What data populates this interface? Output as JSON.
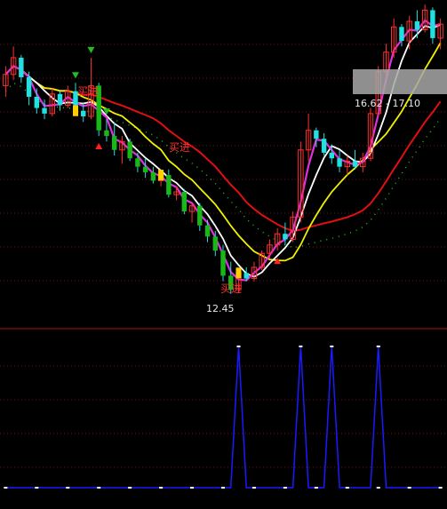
{
  "chart_data": [
    {
      "type": "candlestick",
      "panel": "main",
      "annotations": {
        "buy_labels": [
          "买进",
          "买进",
          "买进"
        ],
        "low_marker": "12.45",
        "price_range_readout": "16.62 - 17.10"
      },
      "candles": [
        {
          "o": 19.9,
          "h": 20.6,
          "l": 19.5,
          "c": 20.3,
          "up": true
        },
        {
          "o": 20.3,
          "h": 21.3,
          "l": 20.1,
          "c": 20.9,
          "up": true
        },
        {
          "o": 20.9,
          "h": 21.0,
          "l": 20.0,
          "c": 20.2,
          "up": false
        },
        {
          "o": 20.2,
          "h": 20.4,
          "l": 19.2,
          "c": 19.5,
          "up": false
        },
        {
          "o": 19.5,
          "h": 19.8,
          "l": 18.9,
          "c": 19.1,
          "up": false
        },
        {
          "o": 19.1,
          "h": 19.4,
          "l": 18.7,
          "c": 18.9,
          "up": false
        },
        {
          "o": 18.9,
          "h": 19.8,
          "l": 18.8,
          "c": 19.6,
          "up": true
        },
        {
          "o": 19.6,
          "h": 19.7,
          "l": 19.0,
          "c": 19.2,
          "up": false
        },
        {
          "o": 19.2,
          "h": 19.9,
          "l": 19.1,
          "c": 19.7,
          "up": true
        },
        {
          "o": 19.7,
          "h": 20.0,
          "l": 18.9,
          "c": 19.0,
          "up": false
        },
        {
          "o": 19.0,
          "h": 19.3,
          "l": 18.6,
          "c": 18.8,
          "up": false
        },
        {
          "o": 18.8,
          "h": 20.9,
          "l": 18.7,
          "c": 19.9,
          "up": true
        },
        {
          "o": 19.9,
          "h": 20.0,
          "l": 18.1,
          "c": 18.3,
          "up": false
        },
        {
          "o": 18.3,
          "h": 18.7,
          "l": 17.9,
          "c": 18.1,
          "up": false
        },
        {
          "o": 18.1,
          "h": 18.6,
          "l": 17.4,
          "c": 17.6,
          "up": false
        },
        {
          "o": 17.6,
          "h": 18.1,
          "l": 17.1,
          "c": 17.9,
          "up": true
        },
        {
          "o": 17.9,
          "h": 18.0,
          "l": 17.2,
          "c": 17.3,
          "up": false
        },
        {
          "o": 17.3,
          "h": 17.5,
          "l": 16.8,
          "c": 17.0,
          "up": false
        },
        {
          "o": 17.0,
          "h": 17.3,
          "l": 16.6,
          "c": 16.8,
          "up": false
        },
        {
          "o": 16.8,
          "h": 17.0,
          "l": 16.4,
          "c": 16.5,
          "up": false
        },
        {
          "o": 16.5,
          "h": 16.8,
          "l": 16.3,
          "c": 16.7,
          "up": true
        },
        {
          "o": 16.7,
          "h": 16.9,
          "l": 15.9,
          "c": 16.0,
          "up": false
        },
        {
          "o": 16.0,
          "h": 16.3,
          "l": 15.8,
          "c": 16.1,
          "up": true
        },
        {
          "o": 16.1,
          "h": 16.2,
          "l": 15.3,
          "c": 15.4,
          "up": false
        },
        {
          "o": 15.4,
          "h": 15.7,
          "l": 15.0,
          "c": 15.6,
          "up": true
        },
        {
          "o": 15.6,
          "h": 15.7,
          "l": 14.7,
          "c": 14.9,
          "up": false
        },
        {
          "o": 14.9,
          "h": 15.1,
          "l": 14.3,
          "c": 14.5,
          "up": false
        },
        {
          "o": 14.5,
          "h": 14.7,
          "l": 13.8,
          "c": 14.0,
          "up": false
        },
        {
          "o": 14.0,
          "h": 14.2,
          "l": 12.9,
          "c": 13.1,
          "up": false
        },
        {
          "o": 13.1,
          "h": 13.6,
          "l": 12.45,
          "c": 12.6,
          "up": false
        },
        {
          "o": 12.6,
          "h": 13.3,
          "l": 12.5,
          "c": 13.2,
          "up": true
        },
        {
          "o": 13.2,
          "h": 13.4,
          "l": 12.9,
          "c": 13.0,
          "up": false
        },
        {
          "o": 13.0,
          "h": 13.6,
          "l": 12.9,
          "c": 13.4,
          "up": true
        },
        {
          "o": 13.4,
          "h": 14.0,
          "l": 13.3,
          "c": 13.9,
          "up": true
        },
        {
          "o": 13.9,
          "h": 14.4,
          "l": 13.7,
          "c": 14.2,
          "up": true
        },
        {
          "o": 14.2,
          "h": 14.8,
          "l": 14.0,
          "c": 14.6,
          "up": true
        },
        {
          "o": 14.6,
          "h": 15.0,
          "l": 14.2,
          "c": 14.4,
          "up": false
        },
        {
          "o": 14.4,
          "h": 15.4,
          "l": 14.3,
          "c": 15.2,
          "up": true
        },
        {
          "o": 15.2,
          "h": 17.9,
          "l": 15.0,
          "c": 17.6,
          "up": true
        },
        {
          "o": 17.6,
          "h": 18.9,
          "l": 17.2,
          "c": 18.3,
          "up": true
        },
        {
          "o": 18.3,
          "h": 18.4,
          "l": 17.7,
          "c": 18.0,
          "up": false
        },
        {
          "o": 18.0,
          "h": 18.2,
          "l": 17.4,
          "c": 17.5,
          "up": false
        },
        {
          "o": 17.5,
          "h": 17.8,
          "l": 17.1,
          "c": 17.3,
          "up": false
        },
        {
          "o": 17.3,
          "h": 17.6,
          "l": 16.8,
          "c": 17.0,
          "up": false
        },
        {
          "o": 17.0,
          "h": 17.4,
          "l": 16.7,
          "c": 17.2,
          "up": true
        },
        {
          "o": 17.2,
          "h": 17.6,
          "l": 16.9,
          "c": 17.0,
          "up": false
        },
        {
          "o": 17.0,
          "h": 17.5,
          "l": 16.8,
          "c": 17.3,
          "up": true
        },
        {
          "o": 17.3,
          "h": 19.1,
          "l": 17.2,
          "c": 18.9,
          "up": true
        },
        {
          "o": 18.9,
          "h": 20.6,
          "l": 18.8,
          "c": 20.4,
          "up": true
        },
        {
          "o": 20.4,
          "h": 21.4,
          "l": 20.1,
          "c": 21.1,
          "up": true
        },
        {
          "o": 21.1,
          "h": 22.3,
          "l": 20.9,
          "c": 22.0,
          "up": true
        },
        {
          "o": 22.0,
          "h": 22.1,
          "l": 21.3,
          "c": 21.5,
          "up": false
        },
        {
          "o": 21.5,
          "h": 22.4,
          "l": 21.2,
          "c": 22.2,
          "up": true
        },
        {
          "o": 22.2,
          "h": 22.6,
          "l": 21.6,
          "c": 21.9,
          "up": false
        },
        {
          "o": 21.9,
          "h": 22.8,
          "l": 21.8,
          "c": 22.6,
          "up": true
        },
        {
          "o": 22.6,
          "h": 22.7,
          "l": 21.4,
          "c": 21.6,
          "up": false
        },
        {
          "o": 21.6,
          "h": 22.3,
          "l": 21.2,
          "c": 22.1,
          "up": true
        }
      ],
      "buy_signals": [
        {
          "index": 9
        },
        {
          "index": 20
        },
        {
          "index": 30
        }
      ],
      "down_markers": [
        9,
        11,
        13
      ],
      "up_markers": [
        12,
        35
      ]
    },
    {
      "type": "line",
      "panel": "indicator",
      "values": [
        0,
        0,
        0,
        0,
        0,
        0,
        0,
        0,
        0,
        0,
        0,
        0,
        0,
        0,
        0,
        0,
        0,
        0,
        0,
        0,
        0,
        0,
        0,
        0,
        0,
        0,
        0,
        0,
        0,
        0,
        1,
        0,
        0,
        0,
        0,
        0,
        0,
        0,
        1,
        0,
        0,
        0,
        1,
        0,
        0,
        0,
        0,
        0,
        1,
        0,
        0,
        0,
        0,
        0,
        0,
        0,
        0
      ],
      "ylim": [
        0,
        1
      ]
    }
  ]
}
